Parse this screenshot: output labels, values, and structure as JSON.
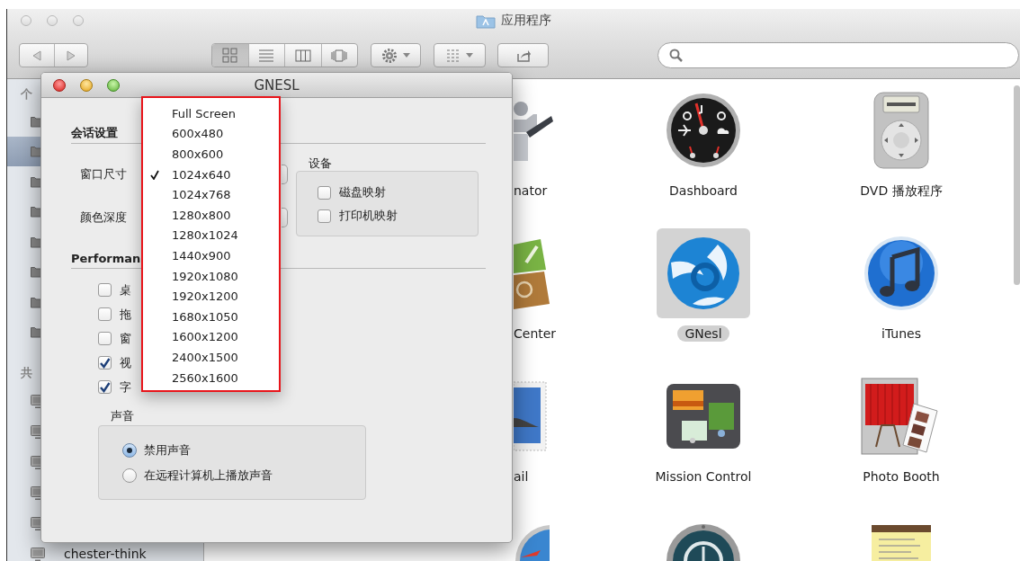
{
  "finder": {
    "title": "应用程序",
    "sidebar": [
      {
        "heading": "个",
        "items": [
          {
            "selected": false
          },
          {
            "selected": true
          },
          {
            "selected": false
          },
          {
            "selected": false
          },
          {
            "selected": false
          },
          {
            "selected": false
          },
          {
            "selected": false
          },
          {
            "selected": false
          }
        ]
      },
      {
        "heading": "共",
        "items": [
          {
            "selected": false
          },
          {
            "selected": false
          },
          {
            "selected": false
          },
          {
            "selected": false
          },
          {
            "selected": false
          },
          {
            "label": "chester-think",
            "selected": false
          }
        ]
      }
    ],
    "apps": [
      [
        {
          "label": "nator",
          "selected": false
        },
        {
          "label": "Dashboard",
          "selected": false
        },
        {
          "label": "DVD 播放程序",
          "selected": false
        }
      ],
      [
        {
          "label": "Center",
          "selected": false
        },
        {
          "label": "GNesl",
          "selected": true
        },
        {
          "label": "iTunes",
          "selected": false
        }
      ],
      [
        {
          "label": "ail",
          "selected": false
        },
        {
          "label": "Mission Control",
          "selected": false
        },
        {
          "label": "Photo Booth",
          "selected": false
        }
      ]
    ]
  },
  "dialog": {
    "title": "GNESL",
    "session": {
      "heading": "会话设置",
      "fields": [
        {
          "label": "窗口尺寸"
        },
        {
          "label": "颜色深度"
        }
      ],
      "devices": {
        "heading": "设备",
        "options": [
          {
            "label": "磁盘映射",
            "checked": false
          },
          {
            "label": "打印机映射",
            "checked": false
          }
        ]
      }
    },
    "performance": {
      "heading": "Performan",
      "options": [
        {
          "label": "桌",
          "checked": false
        },
        {
          "label": "拖",
          "checked": false
        },
        {
          "label": "窗",
          "checked": false
        },
        {
          "label": "视",
          "checked": true
        },
        {
          "label": "字",
          "checked": true
        }
      ]
    },
    "sound": {
      "heading": "声音",
      "options": [
        {
          "label": "禁用声音",
          "selected": true
        },
        {
          "label": "在远程计算机上播放声音",
          "selected": false
        }
      ]
    }
  },
  "menu": {
    "items": [
      {
        "label": "Full Screen",
        "checked": false
      },
      {
        "label": "600x480",
        "checked": false
      },
      {
        "label": "800x600",
        "checked": false
      },
      {
        "label": "1024x640",
        "checked": true
      },
      {
        "label": "1024x768",
        "checked": false
      },
      {
        "label": "1280x800",
        "checked": false
      },
      {
        "label": "1280x1024",
        "checked": false
      },
      {
        "label": "1440x900",
        "checked": false
      },
      {
        "label": "1920x1080",
        "checked": false
      },
      {
        "label": "1920x1200",
        "checked": false
      },
      {
        "label": "1680x1050",
        "checked": false
      },
      {
        "label": "1600x1200",
        "checked": false
      },
      {
        "label": "2400x1500",
        "checked": false
      },
      {
        "label": "2560x1600",
        "checked": false
      }
    ]
  }
}
